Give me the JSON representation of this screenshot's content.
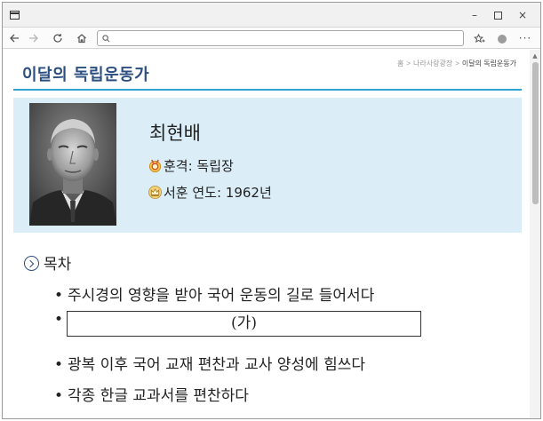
{
  "window": {
    "controls": {
      "minimize": "–",
      "maximize": "",
      "close": "×"
    }
  },
  "navbar": {
    "back_icon": "arrow-left-icon",
    "forward_icon": "arrow-right-icon",
    "reload_icon": "reload-icon",
    "home_icon": "home-icon",
    "search_icon": "search-icon",
    "address_value": "",
    "more_label": "···"
  },
  "breadcrumb": {
    "items": [
      "홈",
      "나라사랑광장",
      "이달의 독립운동가"
    ],
    "separator": ">"
  },
  "page": {
    "title": "이달의 독립운동가",
    "title_color": "#2c4f80",
    "rule_color": "#2ea3cf",
    "card_bg": "#dbeef8"
  },
  "profile": {
    "name": "최현배",
    "honor_label": "훈격: 독립장",
    "year_label": "서훈 연도: 1962년"
  },
  "toc": {
    "heading": "목차",
    "bullet": "•",
    "items": [
      "주시경의 영향을 받아 국어 운동의 길로 들어서다",
      "(가)",
      "광복 이후 국어 교재 편찬과 교사 양성에 힘쓰다",
      "각종 한글 교과서를 편찬하다"
    ]
  }
}
